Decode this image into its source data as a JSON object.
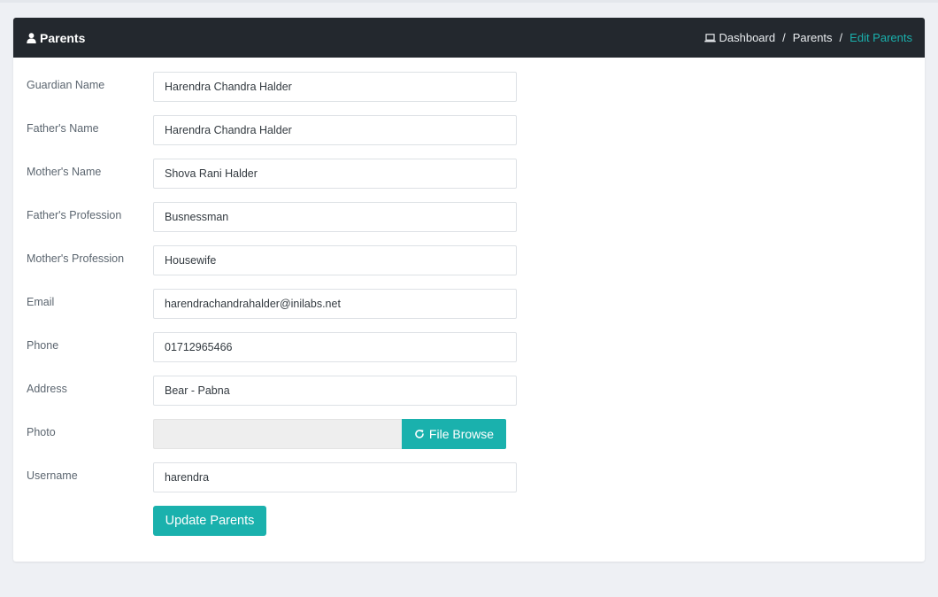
{
  "header": {
    "title": "Parents",
    "title_icon": "user-icon",
    "breadcrumb": {
      "home_icon": "laptop-icon",
      "items": [
        "Dashboard",
        "Parents",
        "Edit Parents"
      ],
      "separator": "/"
    }
  },
  "form": {
    "guardian_name": {
      "label": "Guardian Name",
      "value": "Harendra Chandra Halder"
    },
    "father_name": {
      "label": "Father's Name",
      "value": "Harendra Chandra Halder"
    },
    "mother_name": {
      "label": "Mother's Name",
      "value": "Shova Rani Halder"
    },
    "father_profession": {
      "label": "Father's Profession",
      "value": "Busnessman"
    },
    "mother_profession": {
      "label": "Mother's Profession",
      "value": "Housewife"
    },
    "email": {
      "label": "Email",
      "value": "harendrachandrahalder@inilabs.net"
    },
    "phone": {
      "label": "Phone",
      "value": "01712965466"
    },
    "address": {
      "label": "Address",
      "value": "Bear - Pabna"
    },
    "photo": {
      "label": "Photo",
      "button_label": "File Browse",
      "button_icon": "refresh-icon"
    },
    "username": {
      "label": "Username",
      "value": "harendra"
    },
    "submit_label": "Update Parents"
  },
  "colors": {
    "header_bg": "#23282e",
    "accent": "#1ab1ad",
    "page_bg": "#eef0f4"
  }
}
